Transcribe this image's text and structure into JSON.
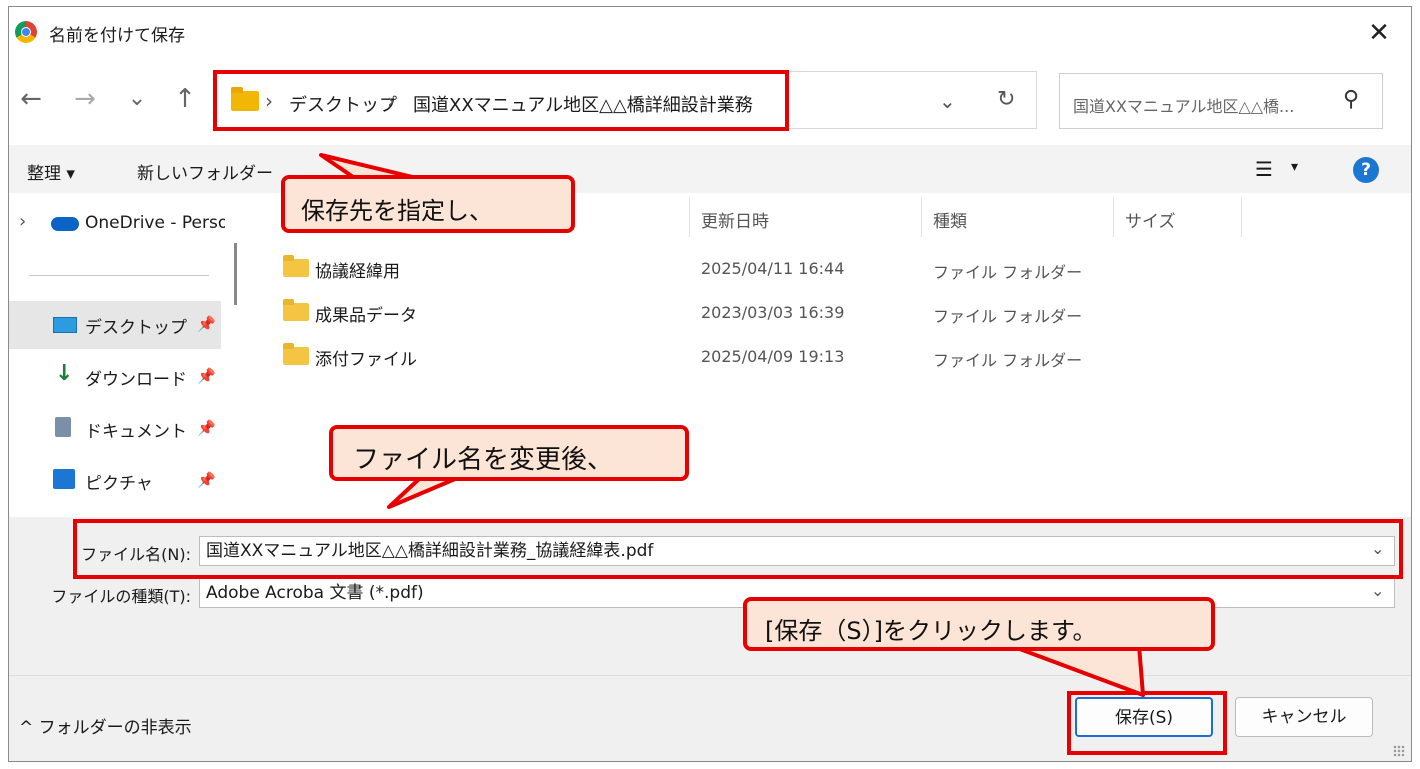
{
  "window": {
    "title": "名前を付けて保存",
    "close": "✕"
  },
  "nav": {
    "back": "←",
    "forward": "→",
    "recent": "⌄",
    "up": "↑",
    "refresh": "↻",
    "addr_dropdown": "⌄"
  },
  "breadcrumb": {
    "sep1": "›",
    "item1": "デスクトップ",
    "sep2": "›",
    "item2": "国道XXマニュアル地区△△橋詳細設計業務"
  },
  "search": {
    "placeholder": "国道XXマニュアル地区△△橋..."
  },
  "toolbar": {
    "organize": "整理 ▾",
    "new_folder": "新しいフォルダー",
    "view": "☰",
    "view_drop": "▾",
    "help": "?"
  },
  "sidebar": {
    "onedrive_expand": "›",
    "onedrive": "OneDrive - Perso",
    "items": [
      {
        "label": "デスクトップ",
        "pin": "📌"
      },
      {
        "label": "ダウンロード",
        "pin": "📌"
      },
      {
        "label": "ドキュメント",
        "pin": "📌"
      },
      {
        "label": "ピクチャ",
        "pin": "📌"
      }
    ]
  },
  "columns": {
    "name": "",
    "date": "更新日時",
    "type": "種類",
    "size": "サイズ"
  },
  "files": [
    {
      "name": "協議経緯用",
      "date": "2025/04/11 16:44",
      "type": "ファイル フォルダー"
    },
    {
      "name": "成果品データ",
      "date": "2023/03/03 16:39",
      "type": "ファイル フォルダー"
    },
    {
      "name": "添付ファイル",
      "date": "2025/04/09 19:13",
      "type": "ファイル フォルダー"
    }
  ],
  "form": {
    "filename_label": "ファイル名(N):",
    "filename_value": "国道XXマニュアル地区△△橋詳細設計業務_協議経緯表.pdf",
    "filetype_label": "ファイルの種類(T):",
    "filetype_value": "Adobe Acroba 文書 (*.pdf)",
    "chev": "⌄"
  },
  "footer": {
    "hide_folders": "^ フォルダーの非表示",
    "save": "保存(S)",
    "cancel": "キャンセル"
  },
  "callouts": {
    "c1": "保存先を指定し、",
    "c2": "ファイル名を変更後、",
    "c3": "[保存（S）]をクリックします。"
  },
  "colors": {
    "annotation_red": "#e60000",
    "callout_fill": "#fce4d6",
    "accent_blue": "#1c6fd1"
  }
}
